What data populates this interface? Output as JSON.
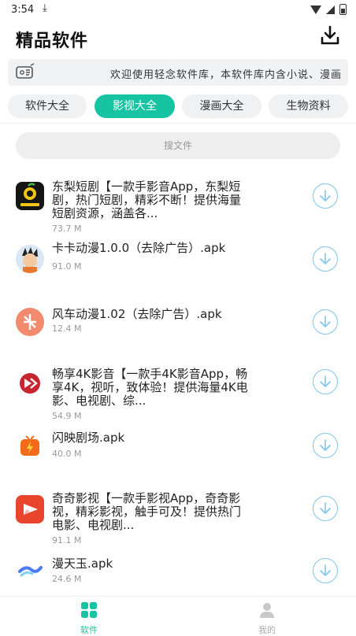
{
  "status_bar": {
    "time": "3:54"
  },
  "header": {
    "title": "精品软件"
  },
  "notice": {
    "text": "欢迎使用轻念软件库，本软件库内含小说、漫画"
  },
  "tabs": [
    {
      "label": "软件大全",
      "active": false
    },
    {
      "label": "影视大全",
      "active": true
    },
    {
      "label": "漫画大全",
      "active": false
    },
    {
      "label": "生物资料",
      "active": false
    }
  ],
  "search": {
    "placeholder": "搜文件"
  },
  "apps": [
    {
      "name": "东梨短剧【一款手影音App，东梨短剧，热门短剧，精彩不断！提供海量短剧资源，涵盖各...",
      "size": "73.7 M",
      "icon": "dongli-icon"
    },
    {
      "name": "卡卡动漫1.0.0（去除广告）.apk",
      "size": "91.0 M",
      "icon": "kaka-icon"
    },
    {
      "name": "风车动漫1.02（去除广告）.apk",
      "size": "12.4 M",
      "icon": "fengche-icon"
    },
    {
      "name": "畅享4K影音【一款手4K影音App，畅享4K，视听，致体验！提供海量4K电影、电视剧、综...",
      "size": "54.9 M",
      "icon": "changxiang-icon"
    },
    {
      "name": "闪映剧场.apk",
      "size": "40.0 M",
      "icon": "shanying-icon"
    },
    {
      "name": "奇奇影视【一款手影视App，奇奇影视，精彩影视，触手可及！提供热门电影、电视剧...",
      "size": "91.1 M",
      "icon": "qiqi-icon"
    },
    {
      "name": "漫天玉.apk",
      "size": "24.6 M",
      "icon": "mantianyu-icon"
    }
  ],
  "bottom_nav": [
    {
      "label": "软件",
      "active": true
    },
    {
      "label": "我的",
      "active": false
    }
  ],
  "colors": {
    "accent": "#16c3a2",
    "download_ring": "#7fc7ec"
  }
}
